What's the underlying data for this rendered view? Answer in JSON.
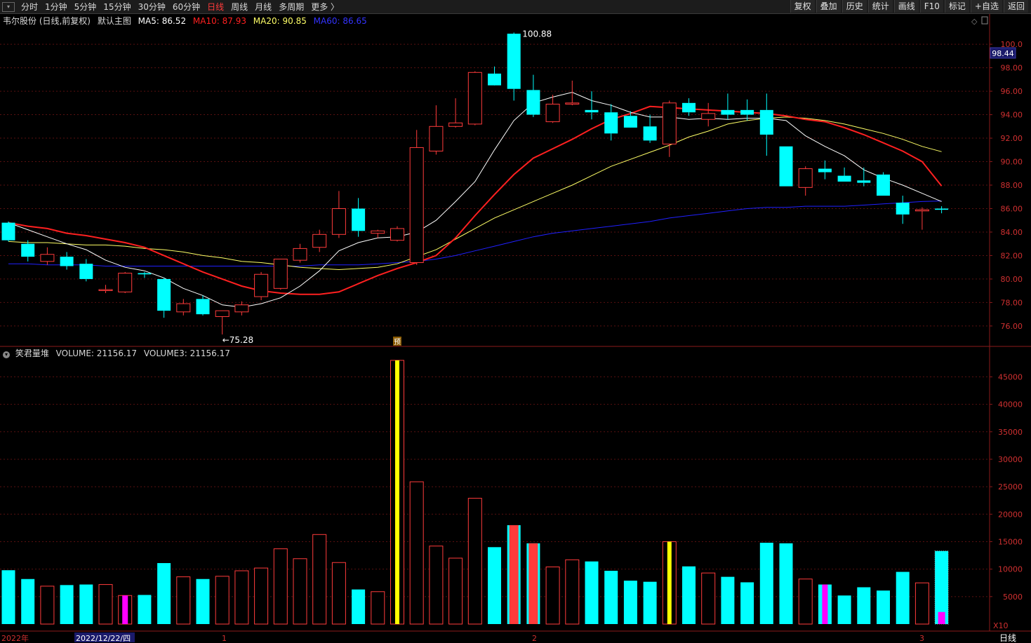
{
  "toolbar": {
    "periods": [
      "分时",
      "1分钟",
      "5分钟",
      "15分钟",
      "30分钟",
      "60分钟",
      "日线",
      "周线",
      "月线",
      "多周期",
      "更多"
    ],
    "more_suffix": "〉",
    "active_period": "日线",
    "buttons": [
      "复权",
      "叠加",
      "历史",
      "统计",
      "画线",
      "F10",
      "标记",
      "+自选",
      "返回"
    ]
  },
  "main_info": {
    "stock": "韦尔股份 (日线,前复权)",
    "template": "默认主图",
    "ma5": "MA5: 86.52",
    "ma10": "MA10: 87.93",
    "ma20": "MA20: 90.85",
    "ma60": "MA60: 86.65"
  },
  "vol_info": {
    "name": "笑君量堆",
    "volume": "VOLUME: 21156.17",
    "volume3": "VOLUME3: 21156.17"
  },
  "colors": {
    "up": "#ff3b3b",
    "down": "#00ffff",
    "ma5": "#ffffff",
    "ma10": "#ff2020",
    "ma20": "#ffff66",
    "ma60": "#2020ff",
    "highlight_yellow": "#ffff00",
    "magenta": "#ff00ff"
  },
  "price_axis": {
    "ticks": [
      "100.0",
      "98.00",
      "96.00",
      "94.00",
      "92.00",
      "90.00",
      "88.00",
      "86.00",
      "84.00",
      "82.00",
      "80.00",
      "78.00",
      "76.00"
    ],
    "current": "98.44"
  },
  "vol_axis": {
    "ticks": [
      "45000",
      "40000",
      "35000",
      "30000",
      "25000",
      "20000",
      "15000",
      "10000",
      "5000"
    ],
    "unit": "X10"
  },
  "date_axis": {
    "year": "2022年",
    "date": "2022/12/22/四",
    "m1": "1",
    "m2": "2",
    "m3": "3",
    "period": "日线"
  },
  "annotations": {
    "high": "100.88",
    "low": "←75.28",
    "pre": "预"
  },
  "chart_data": {
    "type": "candlestick",
    "ohlc": [
      [
        84.8,
        84.9,
        83.2,
        83.3
      ],
      [
        83.0,
        83.3,
        81.5,
        81.9
      ],
      [
        81.5,
        82.7,
        81.2,
        82.1
      ],
      [
        81.9,
        82.3,
        80.8,
        81.1
      ],
      [
        81.3,
        81.7,
        79.8,
        80.0
      ],
      [
        79.1,
        79.5,
        78.8,
        79.1
      ],
      [
        78.9,
        80.6,
        78.8,
        80.5
      ],
      [
        80.5,
        80.6,
        80.1,
        80.4
      ],
      [
        80.0,
        80.1,
        76.7,
        77.3
      ],
      [
        77.2,
        78.3,
        76.9,
        77.9
      ],
      [
        78.3,
        78.6,
        76.9,
        77.0
      ],
      [
        76.8,
        77.3,
        75.28,
        77.3
      ],
      [
        77.2,
        78.1,
        76.9,
        77.8
      ],
      [
        78.5,
        80.6,
        78.2,
        80.4
      ],
      [
        79.2,
        81.7,
        79.1,
        81.7
      ],
      [
        81.6,
        83.0,
        81.4,
        82.6
      ],
      [
        82.7,
        84.2,
        82.3,
        83.8
      ],
      [
        83.8,
        87.5,
        83.5,
        86.0
      ],
      [
        86.0,
        86.9,
        83.6,
        84.1
      ],
      [
        83.9,
        84.2,
        83.5,
        84.1
      ],
      [
        83.3,
        84.5,
        83.2,
        84.3
      ],
      [
        81.4,
        92.7,
        81.2,
        91.2
      ],
      [
        90.9,
        94.8,
        90.6,
        93.0
      ],
      [
        93.0,
        95.4,
        92.9,
        93.3
      ],
      [
        93.2,
        97.7,
        93.1,
        97.6
      ],
      [
        97.5,
        98.1,
        96.8,
        96.5
      ],
      [
        100.9,
        101.0,
        95.2,
        96.2
      ],
      [
        96.1,
        97.4,
        93.8,
        94.0
      ],
      [
        93.4,
        95.7,
        93.3,
        94.9
      ],
      [
        94.9,
        96.9,
        94.8,
        95.0
      ],
      [
        94.4,
        96.0,
        93.6,
        94.2
      ],
      [
        94.2,
        94.9,
        91.8,
        92.4
      ],
      [
        93.9,
        94.3,
        93.0,
        92.9
      ],
      [
        93.0,
        94.0,
        91.6,
        91.8
      ],
      [
        91.5,
        95.2,
        90.4,
        95.0
      ],
      [
        95.0,
        95.4,
        93.9,
        94.2
      ],
      [
        93.6,
        95.0,
        93.0,
        94.1
      ],
      [
        94.4,
        95.8,
        93.6,
        94.0
      ],
      [
        94.4,
        95.3,
        93.5,
        94.0
      ],
      [
        94.4,
        95.8,
        90.5,
        92.3
      ],
      [
        91.3,
        91.3,
        87.9,
        87.9
      ],
      [
        87.8,
        89.6,
        87.1,
        89.4
      ],
      [
        89.4,
        90.1,
        88.5,
        89.1
      ],
      [
        88.8,
        89.5,
        88.3,
        88.3
      ],
      [
        88.4,
        89.5,
        87.9,
        88.2
      ],
      [
        88.9,
        89.1,
        87.1,
        87.1
      ],
      [
        86.5,
        87.1,
        84.7,
        85.5
      ],
      [
        85.8,
        86.1,
        84.2,
        85.9
      ],
      [
        86.0,
        86.2,
        85.6,
        85.9
      ]
    ],
    "ma5": [
      84.8,
      84.2,
      83.6,
      83.0,
      82.5,
      81.6,
      81.0,
      80.7,
      80.1,
      79.2,
      78.6,
      77.8,
      77.6,
      77.9,
      78.4,
      79.4,
      80.7,
      82.4,
      83.1,
      83.5,
      83.6,
      84.0,
      85.0,
      86.6,
      88.3,
      91.0,
      93.5,
      95.0,
      95.5,
      95.9,
      95.2,
      94.8,
      94.2,
      93.8,
      93.8,
      93.6,
      93.7,
      93.6,
      93.7,
      93.7,
      93.5,
      92.2,
      91.3,
      90.5,
      89.3,
      88.6,
      88.0,
      87.3,
      86.6
    ],
    "ma10": [
      84.8,
      84.5,
      84.3,
      83.9,
      83.7,
      83.4,
      83.1,
      82.7,
      82.0,
      81.3,
      80.6,
      80.0,
      79.4,
      79.0,
      78.8,
      78.7,
      78.7,
      78.9,
      79.6,
      80.3,
      80.9,
      81.4,
      82.0,
      83.5,
      85.4,
      87.2,
      88.9,
      90.3,
      91.1,
      91.9,
      92.8,
      93.6,
      94.1,
      94.7,
      94.6,
      94.5,
      94.4,
      94.3,
      94.2,
      94.1,
      93.9,
      93.6,
      93.4,
      92.9,
      92.3,
      91.6,
      90.9,
      90.0,
      87.93
    ],
    "ma20": [
      83.2,
      83.1,
      83.1,
      83.0,
      82.9,
      82.9,
      82.8,
      82.6,
      82.5,
      82.3,
      82.0,
      81.8,
      81.5,
      81.4,
      81.2,
      81.0,
      80.9,
      80.8,
      80.9,
      81.0,
      81.3,
      81.9,
      82.5,
      83.4,
      84.3,
      85.2,
      85.9,
      86.6,
      87.3,
      88.0,
      88.8,
      89.6,
      90.2,
      90.8,
      91.4,
      92.1,
      92.6,
      93.2,
      93.5,
      93.7,
      93.8,
      93.7,
      93.5,
      93.2,
      92.8,
      92.4,
      91.9,
      91.3,
      90.85
    ],
    "ma60": [
      81.3,
      81.3,
      81.2,
      81.2,
      81.2,
      81.1,
      81.1,
      81.1,
      81.1,
      81.1,
      81.1,
      81.1,
      81.1,
      81.1,
      81.1,
      81.1,
      81.2,
      81.2,
      81.2,
      81.3,
      81.4,
      81.5,
      81.7,
      82.0,
      82.4,
      82.8,
      83.2,
      83.6,
      83.9,
      84.1,
      84.3,
      84.5,
      84.7,
      84.9,
      85.2,
      85.4,
      85.6,
      85.8,
      86.0,
      86.1,
      86.1,
      86.2,
      86.2,
      86.2,
      86.3,
      86.4,
      86.5,
      86.6,
      86.65
    ],
    "volume": [
      9800,
      8200,
      6900,
      7100,
      7200,
      7200,
      5200,
      5300,
      11100,
      8600,
      8200,
      8700,
      9700,
      10200,
      13700,
      11900,
      16300,
      11200,
      6300,
      5900,
      48000,
      25900,
      14200,
      12000,
      22900,
      14000,
      18000,
      14700,
      10400,
      11700,
      11400,
      9700,
      7900,
      7700,
      15000,
      10500,
      9300,
      8600,
      7600,
      14800,
      14700,
      8200,
      7200,
      5200,
      6700,
      6100,
      9500,
      7500,
      13300
    ],
    "ylim": [
      74.5,
      101.5
    ],
    "vol_ylim": [
      0,
      48500
    ]
  }
}
